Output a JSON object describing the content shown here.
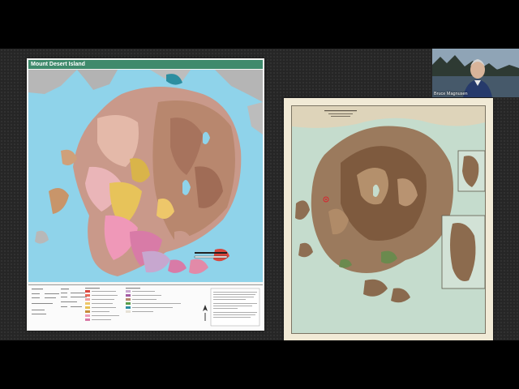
{
  "meeting": {
    "participant_name": "Bruce Magnusen",
    "accent_color": "#3f8a6c"
  },
  "left_map": {
    "title": "Mount Desert Island",
    "legend_headings": [
      "Map Symbology",
      "Faults",
      "Bedrock Units",
      "Surficial Units",
      "Contacts"
    ],
    "legend_colors": [
      "#d9473e",
      "#e86b5b",
      "#f0a0a0",
      "#eec76a",
      "#e8c050",
      "#c68c3a",
      "#ef9bb9",
      "#d87aa7",
      "#c9a6cf",
      "#a45ba4",
      "#5a9e4b",
      "#2d8ea2"
    ]
  },
  "right_map": {
    "caption_lines": [
      "MOUNT DESERT ISLAND",
      "MAINE"
    ],
    "paper_color": "#f1ead6"
  },
  "icons": {
    "north_arrow": "north-arrow-icon",
    "location_marker": "location-marker-icon"
  }
}
